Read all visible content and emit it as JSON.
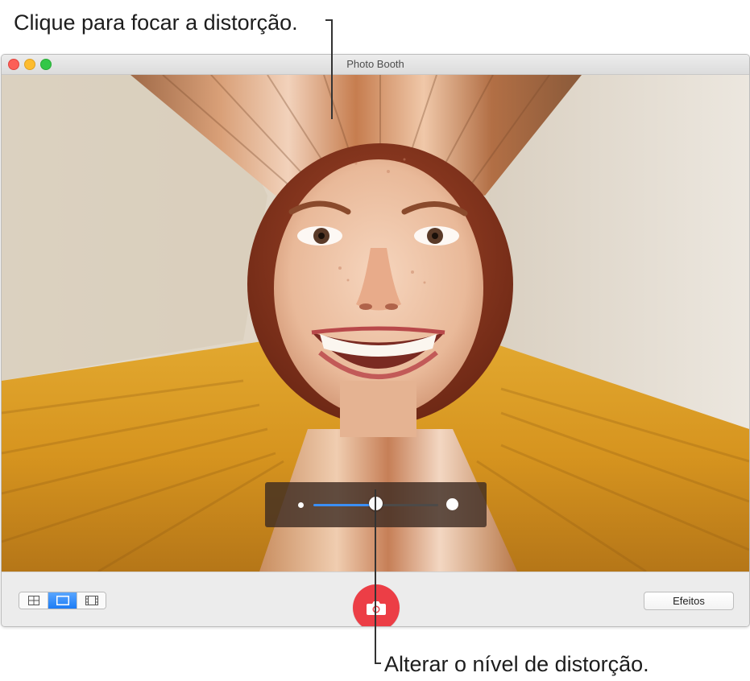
{
  "callouts": {
    "top": "Clique para focar a distorção.",
    "bottom": "Alterar o nível de distorção."
  },
  "window": {
    "title": "Photo Booth"
  },
  "distortion_slider": {
    "value": 0.5
  },
  "toolbar": {
    "layout_modes": [
      "grid-of-four-icon",
      "single-photo-icon",
      "video-clip-icon"
    ],
    "selected_mode": "single-photo-icon",
    "effects_label": "Efeitos"
  },
  "colors": {
    "accent": "#3b8ff5",
    "shutter": "#ec3e46",
    "close": "#fc5f57",
    "minimize": "#fdbc2e",
    "maximize": "#33c748"
  }
}
